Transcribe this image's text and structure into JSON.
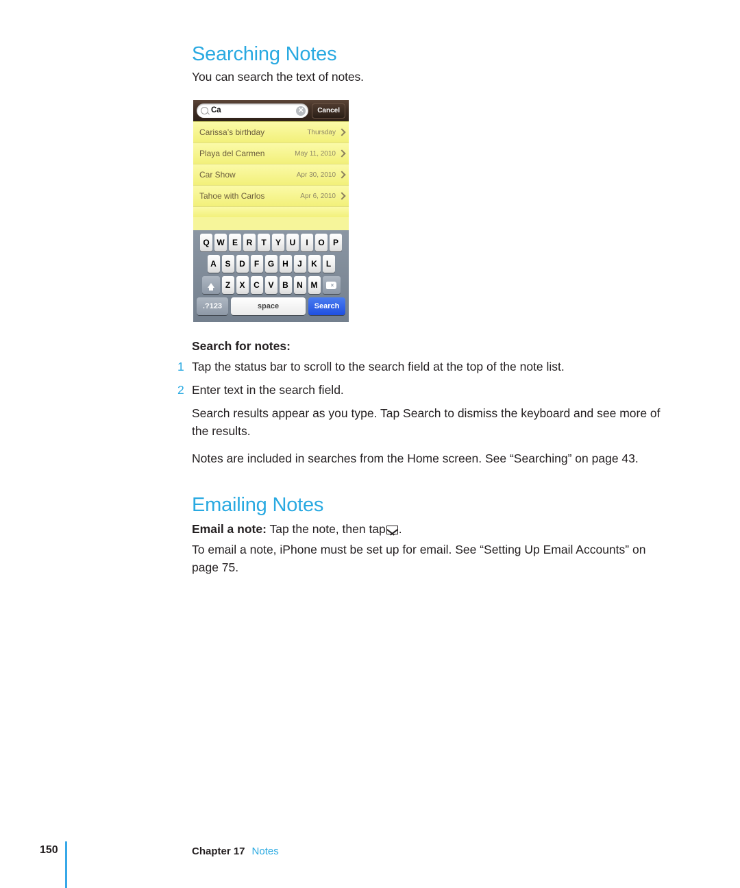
{
  "document": {
    "sections": [
      {
        "heading": "Searching Notes",
        "intro": "You can search the text of notes."
      },
      {
        "heading": "Emailing Notes"
      }
    ]
  },
  "searching": {
    "heading": "Searching Notes",
    "intro": "You can search the text of notes.",
    "procedure_title": "Search for notes:",
    "steps": [
      {
        "num": "1",
        "text": "Tap the status bar to scroll to the search field at the top of the note list."
      },
      {
        "num": "2",
        "text": "Enter text in the search field."
      }
    ],
    "paragraph_results": "Search results appear as you type. Tap Search to dismiss the keyboard and see more of the results.",
    "paragraph_home": "Notes are included in searches from the Home screen. See “Searching” on page 43."
  },
  "emailing": {
    "heading": "Emailing Notes",
    "lead_label": "Email a note:",
    "lead_text_before": "Tap the note, then tap",
    "lead_text_after": ".",
    "paragraph": "To email a note, iPhone must be set up for email. See “Setting Up Email Accounts” on page 75."
  },
  "screenshot": {
    "search_bar": {
      "query": "Ca",
      "clear_label": "✕",
      "cancel_label": "Cancel"
    },
    "results": [
      {
        "title": "Carissa’s birthday",
        "date": "Thursday"
      },
      {
        "title": "Playa del Carmen",
        "date": "May 11, 2010"
      },
      {
        "title": "Car Show",
        "date": "Apr 30, 2010"
      },
      {
        "title": "Tahoe with Carlos",
        "date": "Apr 6, 2010"
      }
    ],
    "keyboard": {
      "row1": [
        "Q",
        "W",
        "E",
        "R",
        "T",
        "Y",
        "U",
        "I",
        "O",
        "P"
      ],
      "row2": [
        "A",
        "S",
        "D",
        "F",
        "G",
        "H",
        "J",
        "K",
        "L"
      ],
      "row3": [
        "Z",
        "X",
        "C",
        "V",
        "B",
        "N",
        "M"
      ],
      "shift_label": "shift",
      "delete_label": "×",
      "numbers_label": ".?123",
      "space_label": "space",
      "search_label": "Search"
    }
  },
  "footer": {
    "page_number": "150",
    "chapter": "Chapter 17",
    "section": "Notes"
  },
  "colors": {
    "heading_blue": "#29a9e1",
    "body_black": "#231f20",
    "note_yellow": "#f6f59a",
    "keyboard_blue": "#1f4fe0"
  }
}
